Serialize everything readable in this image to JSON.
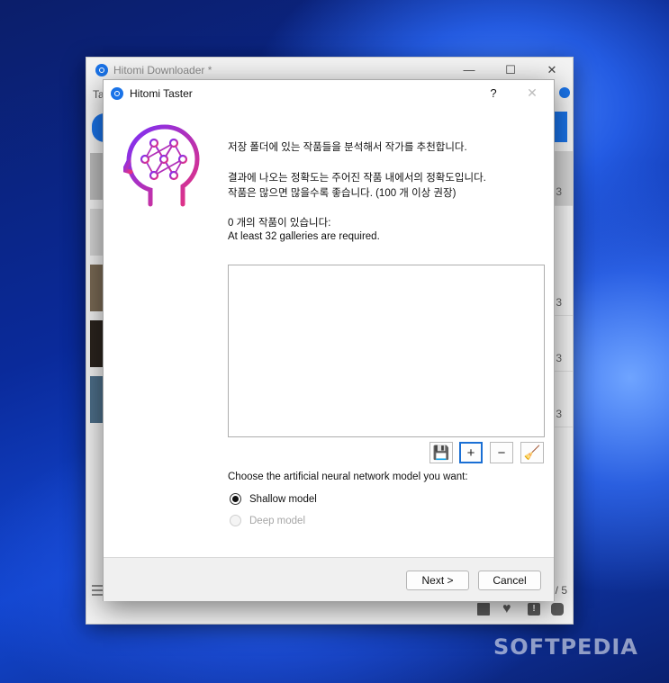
{
  "main_window": {
    "title": "Hitomi Downloader *",
    "tab_fragment": "Ta",
    "row_sizes": [
      "3",
      "3",
      "3",
      "3"
    ],
    "footer_count": "/ 5",
    "footer_icons": [
      "folder-icon",
      "heart-icon",
      "feedback-icon",
      "discord-icon"
    ]
  },
  "dialog": {
    "title": "Hitomi Taster",
    "help": "?",
    "close": "✕",
    "icon": "neural-brain-icon",
    "lines": [
      "저장 폴더에 있는 작품들을 분석해서 작가를 추천합니다.",
      "결과에 나오는 정확도는 주어진 작품 내에서의 정확도입니다.",
      "작품은 많으면 많을수록 좋습니다. (100 개 이상 권장)",
      "0 개의 작품이 있습니다:",
      "At least 32 galleries are required."
    ],
    "toolbar": {
      "save": "💾",
      "add": "+",
      "remove": "−",
      "clean": "🧹"
    },
    "model_prompt": "Choose the artificial neural network model you want:",
    "models": [
      {
        "label": "Shallow model",
        "selected": true,
        "enabled": true
      },
      {
        "label": "Deep model",
        "selected": false,
        "enabled": false
      }
    ],
    "buttons": {
      "next": "Next >",
      "cancel": "Cancel"
    }
  },
  "watermark": "SOFTPEDIA",
  "colors": {
    "accent": "#1a73e8",
    "brain_gradient_start": "#7b2ff7",
    "brain_gradient_end": "#e8327c"
  }
}
